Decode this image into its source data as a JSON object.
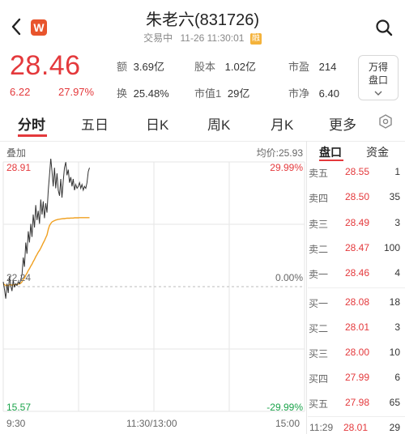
{
  "header": {
    "title": "朱老六(831726)",
    "status": "交易中",
    "datetime": "11-26 11:30:01",
    "rong_badge": "融",
    "app_badge": "W"
  },
  "quote": {
    "price": "28.46",
    "change": "6.22",
    "change_pct": "27.97%",
    "stats": [
      {
        "key": "额",
        "value": "3.69亿"
      },
      {
        "key": "股本",
        "value": "1.02亿"
      },
      {
        "key": "市盈",
        "value": "214"
      },
      {
        "key": "换",
        "value": "25.48%"
      },
      {
        "key": "市值1",
        "value": "29亿"
      },
      {
        "key": "市净",
        "value": "6.40"
      }
    ],
    "wande_label_1": "万得",
    "wande_label_2": "盘口"
  },
  "tabs": [
    "分时",
    "五日",
    "日K",
    "周K",
    "月K",
    "更多"
  ],
  "chart": {
    "overlay_label": "叠加",
    "avg_label": "均价:25.93",
    "y_top_left": "28.91",
    "y_top_right": "29.99%",
    "y_mid_left": "22.24",
    "y_mid_right": "0.00%",
    "y_bottom_left": "15.57",
    "y_bottom_right": "-29.99%",
    "x_start": "9:30",
    "x_mid": "11:30/13:00",
    "x_end": "15:00"
  },
  "chart_data": {
    "type": "line",
    "ylim": [
      15.57,
      28.91
    ],
    "prev_close": 22.24,
    "x_start": "9:30",
    "x_end": "15:00",
    "series": [
      {
        "values": [
          22.5,
          22.1,
          21.6,
          22.4,
          21.9,
          22.8,
          22.3,
          22.0,
          22.6,
          22.2,
          22.4,
          22.3,
          22.5,
          22.4,
          22.6,
          22.9,
          23.8,
          23.3,
          24.6,
          24.0,
          25.2,
          24.6,
          25.6,
          24.9,
          26.1,
          25.4,
          26.6,
          25.8,
          26.3,
          25.6,
          26.9,
          26.1,
          26.8,
          25.9,
          26.7,
          26.2,
          27.4,
          28.2,
          29.1,
          28.4,
          27.6,
          28.6,
          27.5,
          28.3,
          27.4,
          27.1,
          28.0,
          27.0,
          27.9,
          28.6,
          28.9,
          28.2,
          28.5,
          27.8,
          28.1,
          27.6,
          28.0,
          27.4,
          27.7,
          27.5,
          27.6,
          27.8,
          27.5,
          27.7,
          27.4,
          27.6,
          27.5,
          27.8,
          28.4,
          28.6
        ]
      },
      {
        "name": "均价",
        "values": [
          22.4,
          22.35,
          22.3,
          22.32,
          22.3,
          22.35,
          22.34,
          22.32,
          22.35,
          22.34,
          22.35,
          22.36,
          22.38,
          22.39,
          22.42,
          22.5,
          22.62,
          22.7,
          22.85,
          22.96,
          23.1,
          23.2,
          23.34,
          23.44,
          23.58,
          23.7,
          23.84,
          23.96,
          24.08,
          24.18,
          24.3,
          24.44,
          24.58,
          24.7,
          24.86,
          25.0,
          25.3,
          25.5,
          25.62,
          25.7,
          25.74,
          25.77,
          25.8,
          25.82,
          25.84,
          25.85,
          25.86,
          25.87,
          25.88,
          25.88,
          25.89,
          25.9,
          25.9,
          25.9,
          25.91,
          25.91,
          25.91,
          25.92,
          25.92,
          25.92,
          25.92,
          25.93,
          25.93,
          25.93,
          25.93,
          25.93,
          25.93,
          25.93,
          25.93,
          25.93
        ]
      }
    ],
    "total_points": 242
  },
  "orderbook": {
    "tabs": [
      "盘口",
      "资金"
    ],
    "asks": [
      {
        "label": "卖五",
        "price": "28.55",
        "vol": "1"
      },
      {
        "label": "卖四",
        "price": "28.50",
        "vol": "35"
      },
      {
        "label": "卖三",
        "price": "28.49",
        "vol": "3"
      },
      {
        "label": "卖二",
        "price": "28.47",
        "vol": "100"
      },
      {
        "label": "卖一",
        "price": "28.46",
        "vol": "4"
      }
    ],
    "bids": [
      {
        "label": "买一",
        "price": "28.08",
        "vol": "18"
      },
      {
        "label": "买二",
        "price": "28.01",
        "vol": "3"
      },
      {
        "label": "买三",
        "price": "28.00",
        "vol": "10"
      },
      {
        "label": "买四",
        "price": "27.99",
        "vol": "6"
      },
      {
        "label": "买五",
        "price": "27.98",
        "vol": "65"
      }
    ],
    "trade": {
      "time": "11:29",
      "price": "28.01",
      "vol": "29"
    }
  },
  "colors": {
    "up": "#e4393c",
    "down": "#1aa34a",
    "accent": "#e8542c",
    "avg": "#f0a020"
  }
}
